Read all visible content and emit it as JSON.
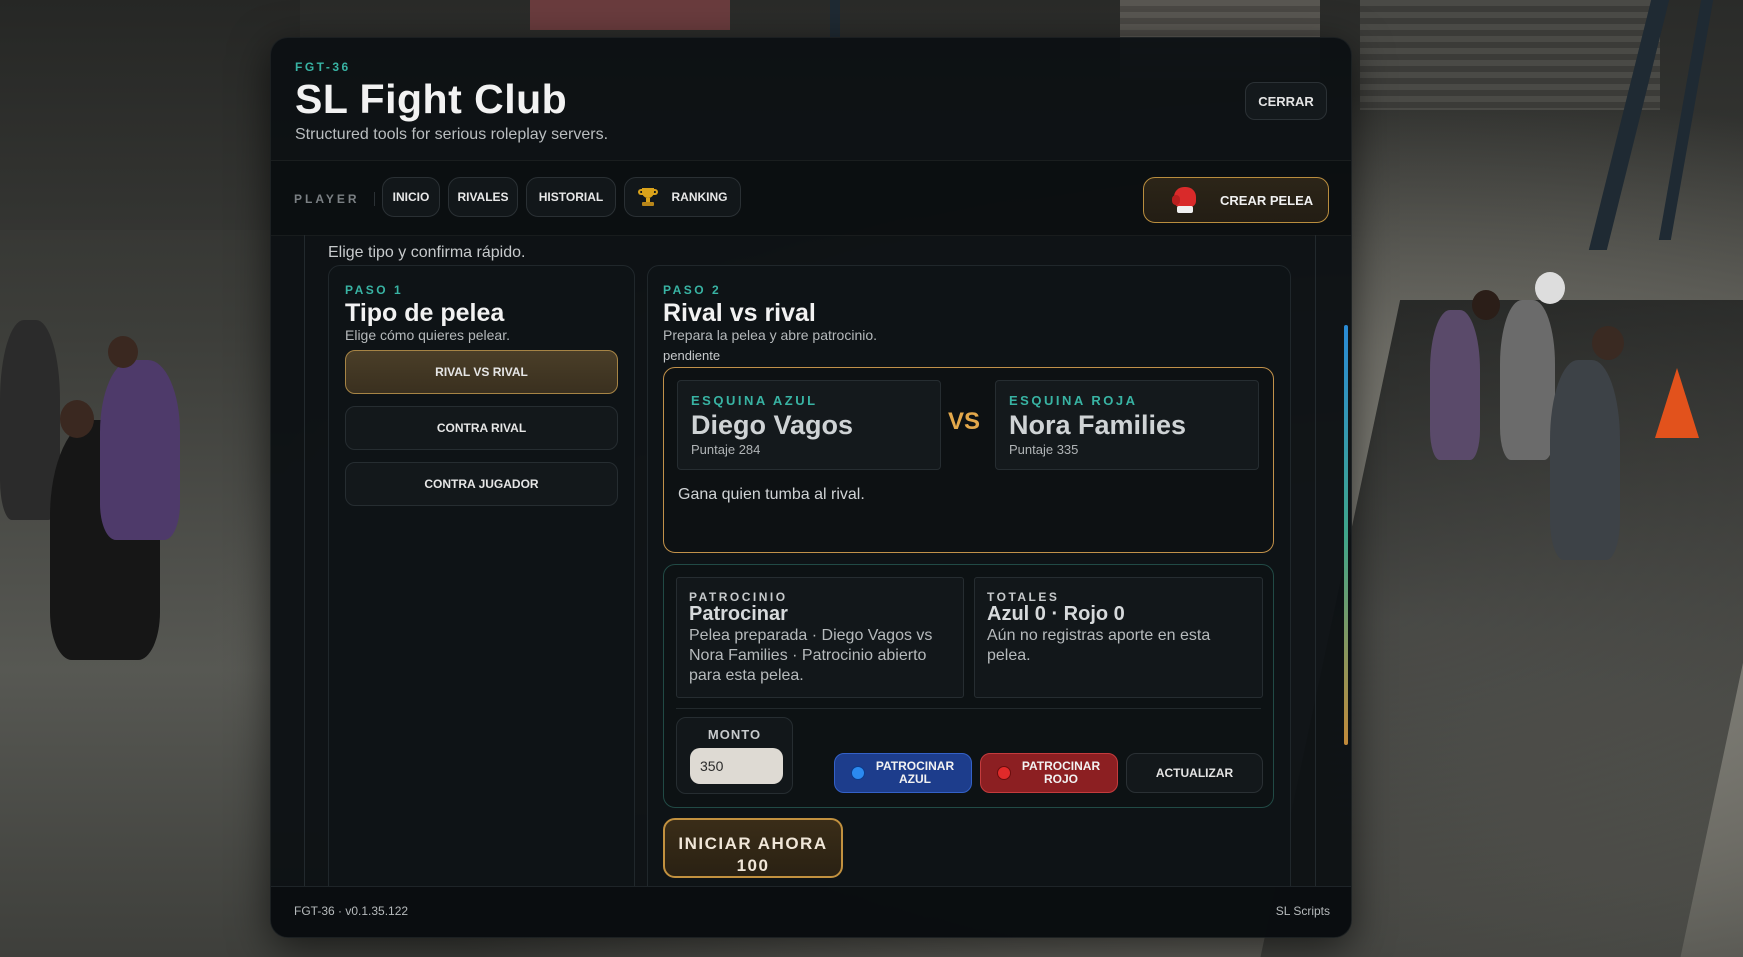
{
  "app": {
    "code": "FGT-36",
    "title": "SL Fight Club",
    "subtitle": "Structured tools for serious roleplay servers.",
    "close_label": "CERRAR"
  },
  "nav": {
    "role_label": "PLAYER",
    "tabs": [
      {
        "label": "INICIO"
      },
      {
        "label": "RIVALES"
      },
      {
        "label": "HISTORIAL"
      },
      {
        "label": "RANKING",
        "icon": "trophy-icon"
      }
    ],
    "create_label": "CREAR PELEA",
    "create_icon": "boxing-glove-icon"
  },
  "hint": "Elige tipo y confirma rápido.",
  "step1": {
    "kicker": "PASO 1",
    "title": "Tipo de pelea",
    "description": "Elige cómo quieres pelear.",
    "options": [
      {
        "label": "RIVAL VS RIVAL",
        "active": true
      },
      {
        "label": "CONTRA RIVAL",
        "active": false
      },
      {
        "label": "CONTRA JUGADOR",
        "active": false
      }
    ]
  },
  "step2": {
    "kicker": "PASO 2",
    "title": "Rival vs rival",
    "description": "Prepara la pelea y abre patrocinio.",
    "status": "pendiente",
    "blue_corner": {
      "kicker": "ESQUINA AZUL",
      "name": "Diego Vagos",
      "score": "Puntaje 284"
    },
    "red_corner": {
      "kicker": "ESQUINA ROJA",
      "name": "Nora Families",
      "score": "Puntaje 335"
    },
    "vs_label": "VS",
    "rule": "Gana quien tumba al rival."
  },
  "sponsorship": {
    "kicker": "PATROCINIO",
    "title": "Patrocinar",
    "body": "Pelea preparada · Diego Vagos vs Nora Families · Patrocinio abierto para esta pelea.",
    "totals_kicker": "TOTALES",
    "totals_title": "Azul 0 · Rojo 0",
    "totals_body": "Aún no registras aporte en esta pelea.",
    "amount_label": "MONTO",
    "amount_value": "350",
    "blue_button": "PATROCINAR AZUL",
    "red_button": "PATROCINAR ROJO",
    "refresh_button": "ACTUALIZAR"
  },
  "start": {
    "line1": "INICIAR AHORA",
    "line2": "100"
  },
  "footer": {
    "version": "FGT-36 · v0.1.35.122",
    "brand": "SL Scripts"
  },
  "colors": {
    "accent_teal": "#38b3a3",
    "accent_gold": "#c1914a",
    "blue": "#1d3d8c",
    "red": "#8c1f22"
  }
}
